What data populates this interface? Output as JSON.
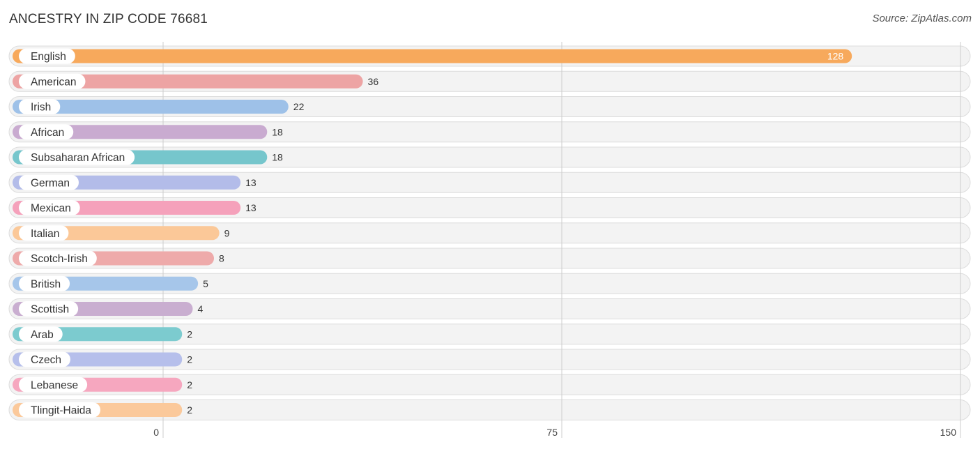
{
  "header": {
    "title": "ANCESTRY IN ZIP CODE 76681",
    "source": "Source: ZipAtlas.com"
  },
  "chart_data": {
    "type": "bar",
    "orientation": "horizontal",
    "title": "ANCESTRY IN ZIP CODE 76681",
    "xlabel": "",
    "ylabel": "",
    "xlim": [
      0,
      150
    ],
    "ticks": [
      0,
      75,
      150
    ],
    "tick_labels": [
      "0",
      "75",
      "150"
    ],
    "grid": true,
    "categories": [
      "English",
      "American",
      "Irish",
      "African",
      "Subsaharan African",
      "German",
      "Mexican",
      "Italian",
      "Scotch-Irish",
      "British",
      "Scottish",
      "Arab",
      "Czech",
      "Lebanese",
      "Tlingit-Haida"
    ],
    "values": [
      128,
      36,
      22,
      18,
      18,
      13,
      13,
      9,
      8,
      5,
      4,
      2,
      2,
      2,
      2
    ],
    "value_labels": [
      "128",
      "36",
      "22",
      "18",
      "18",
      "13",
      "13",
      "9",
      "8",
      "5",
      "4",
      "2",
      "2",
      "2",
      "2"
    ],
    "colors": [
      "#f7a95c",
      "#eda4a4",
      "#9ec1e8",
      "#c9abd0",
      "#76c6cc",
      "#b3bce9",
      "#f5a1bb",
      "#fbc898",
      "#eeaaaa",
      "#a6c6ea",
      "#c9aed0",
      "#7ccbcf",
      "#b6bfeb",
      "#f6a7bf",
      "#fbc99b"
    ]
  }
}
